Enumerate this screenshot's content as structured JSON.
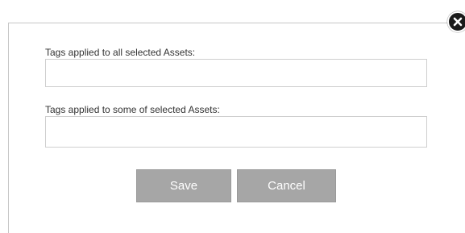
{
  "dialog": {
    "all_tags_label": "Tags applied to all selected Assets:",
    "all_tags_value": "",
    "some_tags_label": "Tags applied to some of selected Assets:",
    "some_tags_value": "",
    "save_label": "Save",
    "cancel_label": "Cancel",
    "close_icon": "close-icon"
  },
  "colors": {
    "button_bg": "#a6a6a6",
    "button_text": "#ffffff",
    "close_bg": "#1b1b1b",
    "input_border": "#cfcfcf"
  }
}
